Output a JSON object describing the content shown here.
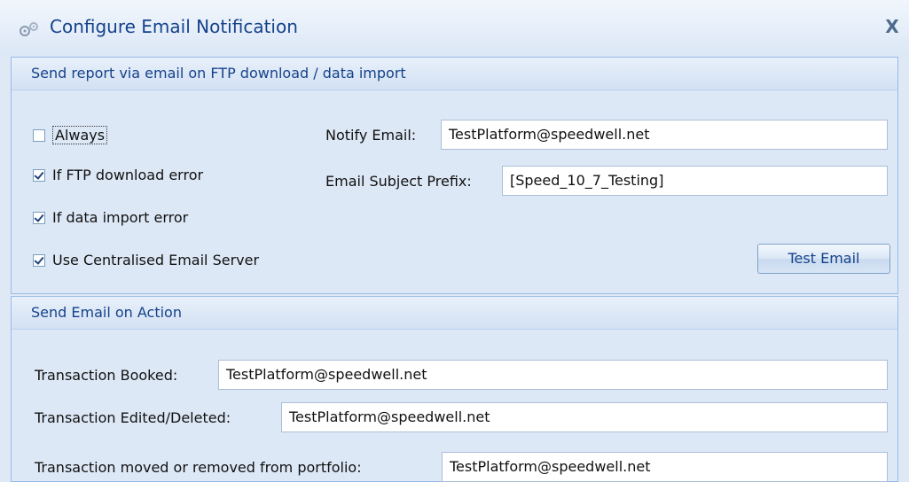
{
  "window": {
    "title": "Configure Email Notification",
    "close_label": "X"
  },
  "report_section": {
    "title": "Send report via email on FTP download / data import",
    "checkboxes": [
      {
        "label": "Always",
        "checked": false
      },
      {
        "label": "If FTP download error",
        "checked": true
      },
      {
        "label": "If data import error",
        "checked": true
      },
      {
        "label": "Use Centralised Email Server",
        "checked": true
      }
    ],
    "notify_email_label": "Notify Email:",
    "notify_email_value": "TestPlatform@speedwell.net",
    "subject_prefix_label": "Email Subject Prefix:",
    "subject_prefix_value": "[Speed_10_7_Testing]",
    "test_email_button": "Test Email"
  },
  "action_section": {
    "title": "Send Email on Action",
    "rows": [
      {
        "label": "Transaction Booked:",
        "value": "TestPlatform@speedwell.net"
      },
      {
        "label": "Transaction Edited/Deleted:",
        "value": "TestPlatform@speedwell.net"
      },
      {
        "label": "Transaction moved or removed from portfolio:",
        "value": "TestPlatform@speedwell.net"
      }
    ]
  },
  "colors": {
    "accent": "#15428b",
    "background": "#dfe9f5",
    "border": "#99bbe8"
  }
}
